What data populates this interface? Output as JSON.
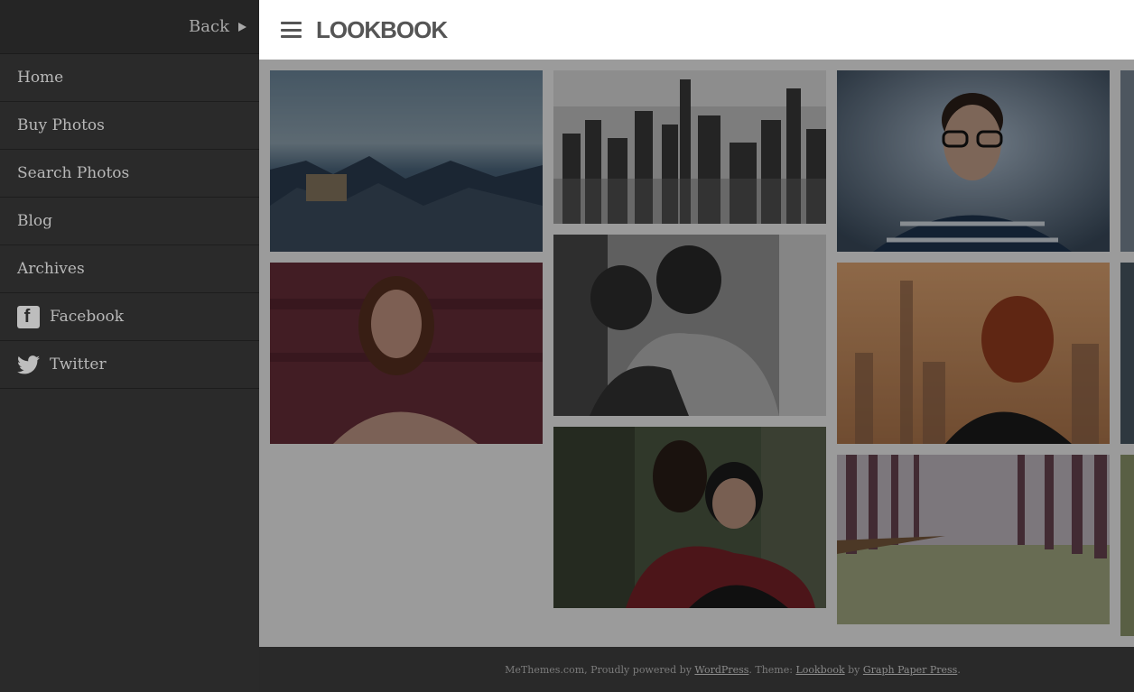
{
  "sidebar": {
    "back_label": "Back",
    "items": [
      {
        "label": "Home"
      },
      {
        "label": "Buy Photos"
      },
      {
        "label": "Search Photos"
      },
      {
        "label": "Blog"
      },
      {
        "label": "Archives"
      },
      {
        "label": "Facebook",
        "icon": "facebook-icon"
      },
      {
        "label": "Twitter",
        "icon": "twitter-icon"
      }
    ]
  },
  "header": {
    "logo": "LOOKBOOK"
  },
  "footer": {
    "prefix": "MeThemes.com, Proudly powered by ",
    "wordpress": "WordPress",
    "theme_text": ". Theme: ",
    "theme": "Lookbook",
    "by_text": " by ",
    "author": "Graph Paper Press",
    "suffix": "."
  },
  "colors": {
    "sidebar_bg": "#2a2a2a",
    "overlay": "#9b9b9b",
    "text": "#b8b8b8"
  }
}
